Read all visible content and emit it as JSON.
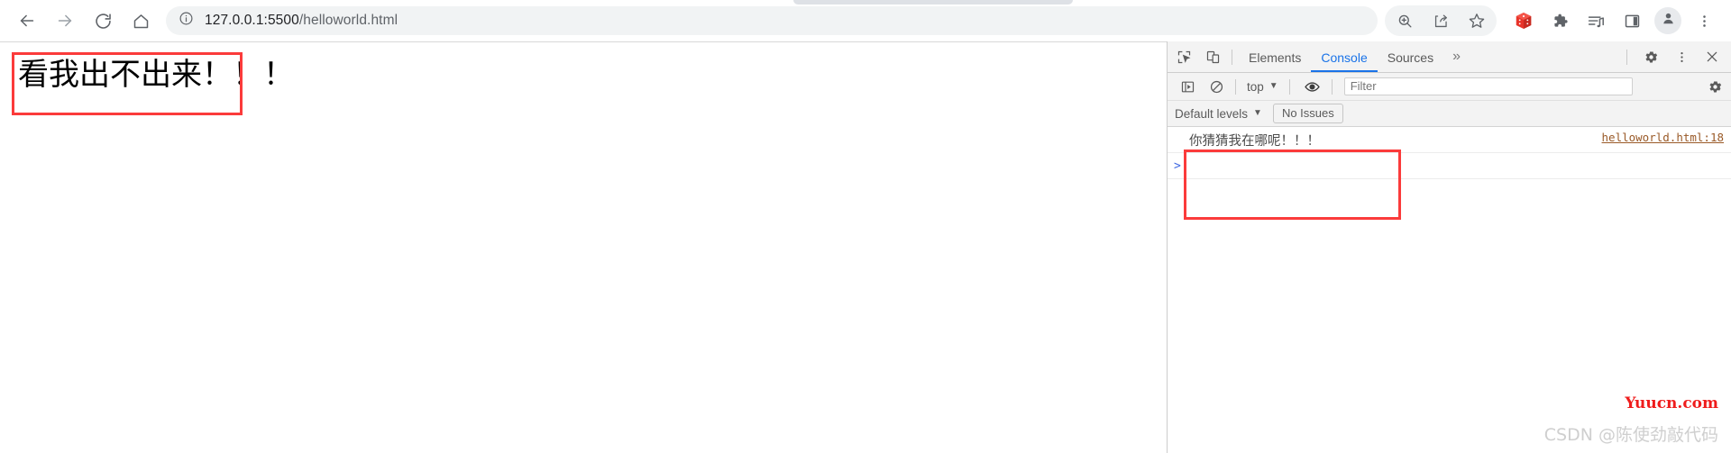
{
  "browser": {
    "nav": {
      "back_icon": "arrow-left-icon",
      "forward_icon": "arrow-right-icon",
      "reload_icon": "reload-icon",
      "home_icon": "home-icon"
    },
    "omnibox": {
      "info_icon": "info-circle-icon",
      "url_host": "127.0.0.1:5500",
      "url_path": "/helloworld.html",
      "url_full": "127.0.0.1:5500/helloworld.html"
    },
    "actions": [
      {
        "name": "zoom-in-icon",
        "label": "Zoom"
      },
      {
        "name": "share-icon",
        "label": "Share this page"
      },
      {
        "name": "star-icon",
        "label": "Bookmark this tab"
      },
      {
        "name": "dice-extension-icon",
        "label": "Extension"
      },
      {
        "name": "puzzle-icon",
        "label": "Extensions"
      },
      {
        "name": "media-list-icon",
        "label": "Media"
      },
      {
        "name": "side-panel-icon",
        "label": "Side panel"
      },
      {
        "name": "avatar-icon",
        "label": "Profile"
      },
      {
        "name": "kebab-menu-icon",
        "label": "Customize and control Google Chrome"
      }
    ]
  },
  "page": {
    "heading": "看我出不出来！！！",
    "annotation_color": "#fb3b3b"
  },
  "devtools": {
    "inspect_icon": "inspect-element-icon",
    "device_icon": "device-toolbar-icon",
    "tabs": [
      {
        "label": "Elements",
        "active": false
      },
      {
        "label": "Console",
        "active": true
      },
      {
        "label": "Sources",
        "active": false
      }
    ],
    "more_tabs": "»",
    "settings_icon": "gear-icon",
    "kebab_icon": "kebab-menu-icon",
    "close_icon": "close-icon",
    "console_toolbar": {
      "sidebar_icon": "console-sidebar-icon",
      "clear_icon": "clear-console-icon",
      "context": "top",
      "context_caret": "▼",
      "eye_icon": "live-expression-eye-icon",
      "filter_placeholder": "Filter",
      "filter_value": "",
      "settings_icon": "console-settings-gear-icon"
    },
    "levels_bar": {
      "levels_label": "Default levels",
      "levels_caret": "▼",
      "issues_label": "No Issues"
    },
    "messages": [
      {
        "text": "你猜猜我在哪呢！！！",
        "source": "helloworld.html:18"
      }
    ],
    "prompt_caret": ">",
    "annotation_color": "#fb3b3b"
  },
  "watermarks": {
    "yuucn": "Yuucn.com",
    "csdn": "CSDN @陈使劲敲代码"
  }
}
